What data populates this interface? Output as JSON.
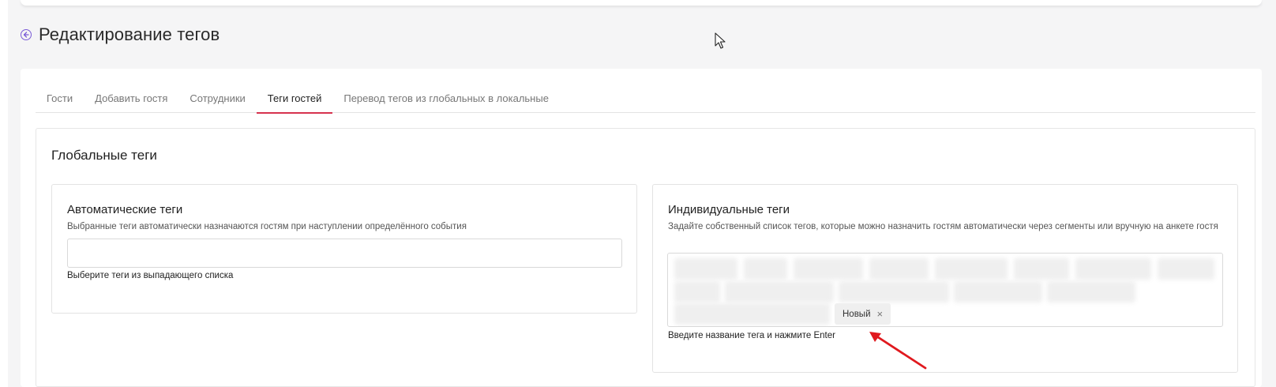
{
  "header": {
    "title": "Редактирование тегов"
  },
  "tabs": [
    {
      "label": "Гости"
    },
    {
      "label": "Добавить гостя"
    },
    {
      "label": "Сотрудники"
    },
    {
      "label": "Теги гостей",
      "active": true
    },
    {
      "label": "Перевод тегов из глобальных в локальные"
    }
  ],
  "section": {
    "title": "Глобальные теги"
  },
  "auto_tags": {
    "title": "Автоматические теги",
    "description": "Выбранные теги автоматически назначаются гостям при наступлении определённого события",
    "input_value": "",
    "hint": "Выберите теги из выпадающего списка"
  },
  "individual_tags": {
    "title": "Индивидуальные теги",
    "description": "Задайте собственный список тегов, которые можно назначить гостям автоматически через сегменты или вручную на анкете гостя",
    "tags": [
      "Новый"
    ],
    "remove_glyph": "×",
    "hint": "Введите название тега и нажмите Enter"
  },
  "colors": {
    "accent_tab": "#d6324e",
    "back_icon": "#7a5bd6",
    "annotation_arrow": "#e0191e"
  }
}
